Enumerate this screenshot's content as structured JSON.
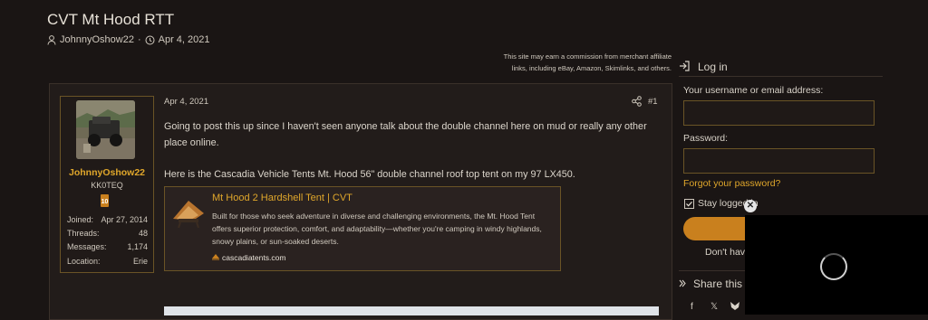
{
  "thread": {
    "title": "CVT Mt Hood RTT",
    "author": "JohnnyOshow22",
    "separator": "·",
    "date": "Apr 4, 2021"
  },
  "disclaimer": {
    "line1": "This site may earn a commission from merchant affiliate",
    "line2": "links, including eBay, Amazon, Skimlinks, and others."
  },
  "post": {
    "date": "Apr 4, 2021",
    "number": "#1",
    "paragraph1_line1": "Going to post this up since I haven't seen anyone talk about the double channel here on mud or really any other",
    "paragraph1_line2": "place online.",
    "paragraph2": "Here is the Cascadia Vehicle Tents Mt. Hood 56\" double channel roof top tent on my 97 LX450."
  },
  "user": {
    "name": "JohnnyOshow22",
    "title": "KK0TEQ",
    "badge": "10",
    "stats": [
      {
        "label": "Joined:",
        "value": "Apr 27, 2014"
      },
      {
        "label": "Threads:",
        "value": "48"
      },
      {
        "label": "Messages:",
        "value": "1,174"
      },
      {
        "label": "Location:",
        "value": "Erie"
      }
    ]
  },
  "unfurl": {
    "title": "Mt Hood 2 Hardshell Tent | CVT",
    "description": "Built for those who seek adventure in diverse and challenging environments, the Mt. Hood Tent offers superior protection, comfort, and adaptability—whether you're camping in windy highlands, snowy plains, or sun-soaked deserts.",
    "domain": "cascadiatents.com"
  },
  "sidebar": {
    "login_heading": "Log in",
    "username_label": "Your username or email address:",
    "password_label": "Password:",
    "forgot": "Forgot your password?",
    "stay_logged": "Stay logged in",
    "dont_have": "Don't hav",
    "share_heading": "Share this"
  },
  "overlay": {
    "close": "✕"
  },
  "colors": {
    "accent": "#e0a72b",
    "button": "#c9801e",
    "background": "#1a1514"
  }
}
